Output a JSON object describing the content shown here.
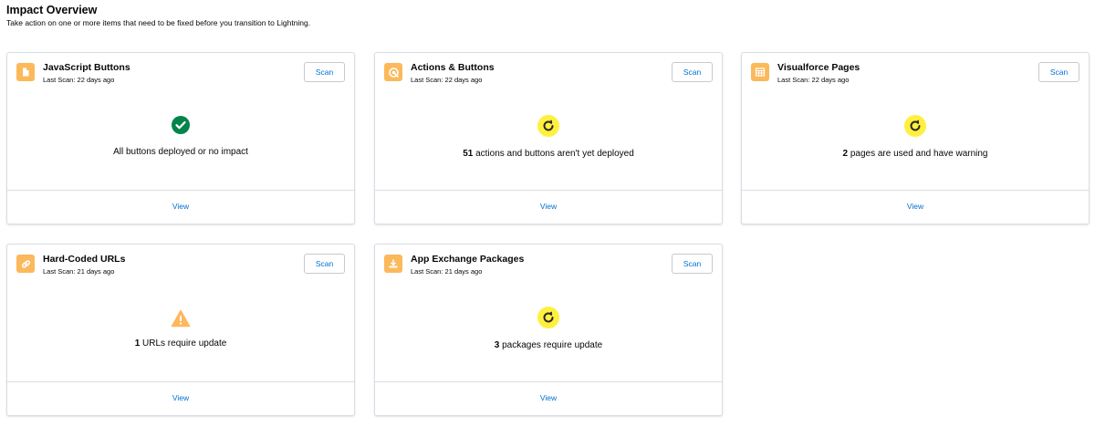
{
  "header": {
    "title": "Impact Overview",
    "subtitle": "Take action on one or more items that need to be fixed before you transition to Lightning."
  },
  "colors": {
    "icon_bg": "#fcb95b",
    "link": "#0070d2",
    "success": "#04844b",
    "warning": "#ffb75d",
    "pending": "#fff03f"
  },
  "cards": [
    {
      "title": "JavaScript Buttons",
      "last_scan": "Last Scan: 22 days ago",
      "scan_label": "Scan",
      "icon": "document-icon",
      "status": "success",
      "count": "",
      "message": "All buttons deployed or no impact",
      "view_label": "View"
    },
    {
      "title": "Actions & Buttons",
      "last_scan": "Last Scan: 22 days ago",
      "scan_label": "Scan",
      "icon": "action-icon",
      "status": "pending",
      "count": "51",
      "message": " actions and buttons aren't yet deployed",
      "view_label": "View"
    },
    {
      "title": "Visualforce Pages",
      "last_scan": "Last Scan: 22 days ago",
      "scan_label": "Scan",
      "icon": "table-icon",
      "status": "pending",
      "count": "2",
      "message": " pages are used and have warning",
      "view_label": "View"
    },
    {
      "title": "Hard-Coded URLs",
      "last_scan": "Last Scan: 21 days ago",
      "scan_label": "Scan",
      "icon": "link-icon",
      "status": "warning",
      "count": "1",
      "message": " URLs require update",
      "view_label": "View"
    },
    {
      "title": "App Exchange Packages",
      "last_scan": "Last Scan: 21 days ago",
      "scan_label": "Scan",
      "icon": "download-icon",
      "status": "pending",
      "count": "3",
      "message": " packages require update",
      "view_label": "View"
    }
  ]
}
